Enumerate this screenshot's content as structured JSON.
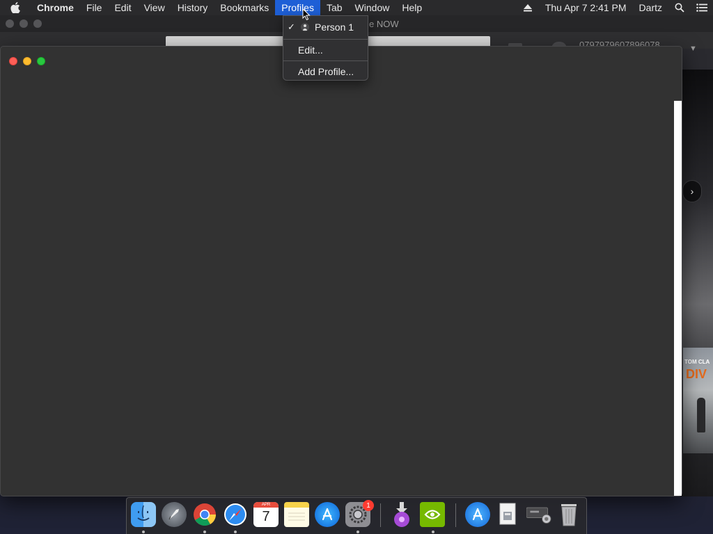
{
  "menubar": {
    "app_name": "Chrome",
    "items": [
      "File",
      "Edit",
      "View",
      "History",
      "Bookmarks",
      "Profiles",
      "Tab",
      "Window",
      "Help"
    ],
    "active_item": "Profiles",
    "clock": "Thu Apr 7  2:41 PM",
    "user": "Dartz"
  },
  "profiles_menu": {
    "items": [
      {
        "label": "Person 1",
        "checked": true
      },
      {
        "label": "Edit..."
      },
      {
        "label": "Add Profile..."
      }
    ]
  },
  "back_window": {
    "title_fragment": "e NOW",
    "right_text": "0797979607896078"
  },
  "background_page": {
    "game_brand": "TOM CLA",
    "game_logo": "DIV"
  },
  "dock": {
    "items": [
      {
        "name": "Finder",
        "running": true
      },
      {
        "name": "Launchpad",
        "running": false
      },
      {
        "name": "Google Chrome",
        "running": true
      },
      {
        "name": "Safari",
        "running": true
      },
      {
        "name": "Calendar",
        "running": false,
        "month": "APR",
        "day": "7"
      },
      {
        "name": "Notes",
        "running": false
      },
      {
        "name": "App Store",
        "running": false
      },
      {
        "name": "System Preferences",
        "running": true,
        "badge": "1"
      },
      {
        "name": "Installer",
        "running": false
      },
      {
        "name": "NVIDIA",
        "running": true
      },
      {
        "name": "Applications",
        "running": false
      },
      {
        "name": "Documents",
        "running": false
      },
      {
        "name": "Downloads",
        "running": false
      },
      {
        "name": "Trash",
        "running": false
      }
    ]
  },
  "colors": {
    "menu_highlight": "#1e5fd6",
    "window_bg": "#323232"
  }
}
